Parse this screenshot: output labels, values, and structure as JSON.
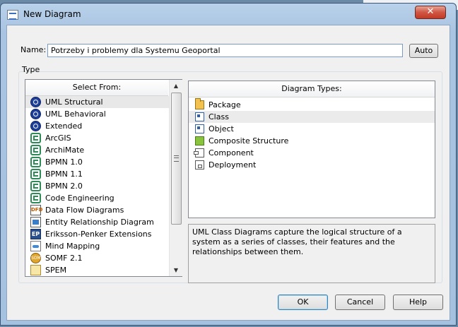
{
  "window": {
    "title": "New Diagram",
    "close_glyph": "✕"
  },
  "name_field": {
    "label": "Name:",
    "value": "Potrzeby i problemy dla Systemu Geoportal",
    "auto_button": "Auto"
  },
  "type_group": {
    "label": "Type"
  },
  "select_from": {
    "header": "Select From:",
    "items": [
      {
        "label": "UML Structural",
        "icon": "uml-icon",
        "selected": true
      },
      {
        "label": "UML Behavioral",
        "icon": "uml-icon"
      },
      {
        "label": "Extended",
        "icon": "uml-icon"
      },
      {
        "label": "ArcGIS",
        "icon": "technology-icon"
      },
      {
        "label": "ArchiMate",
        "icon": "technology-icon"
      },
      {
        "label": "BPMN 1.0",
        "icon": "technology-icon"
      },
      {
        "label": "BPMN 1.1",
        "icon": "technology-icon"
      },
      {
        "label": "BPMN 2.0",
        "icon": "technology-icon"
      },
      {
        "label": "Code Engineering",
        "icon": "technology-icon"
      },
      {
        "label": "Data Flow Diagrams",
        "icon": "dfd-icon"
      },
      {
        "label": "Entity Relationship Diagram",
        "icon": "erd-icon"
      },
      {
        "label": "Eriksson-Penker Extensions",
        "icon": "eriksson-penker-icon"
      },
      {
        "label": "Mind Mapping",
        "icon": "mind-mapping-icon"
      },
      {
        "label": "SOMF 2.1",
        "icon": "somf-icon"
      },
      {
        "label": "SPEM",
        "icon": "spem-icon"
      }
    ],
    "dfd_icon_text": "DFD",
    "ep_icon_text": "EP",
    "somf_icon_text": "SOMF"
  },
  "diagram_types": {
    "header": "Diagram Types:",
    "items": [
      {
        "label": "Package",
        "icon": "package-icon"
      },
      {
        "label": "Class",
        "icon": "class-icon",
        "selected": true
      },
      {
        "label": "Object",
        "icon": "object-icon"
      },
      {
        "label": "Composite Structure",
        "icon": "composite-structure-icon"
      },
      {
        "label": "Component",
        "icon": "component-icon"
      },
      {
        "label": "Deployment",
        "icon": "deployment-icon"
      }
    ]
  },
  "description": "UML Class Diagrams capture the logical structure of a system as a series of classes, their features and the relationships between them.",
  "buttons": {
    "ok": "OK",
    "cancel": "Cancel",
    "help": "Help"
  },
  "scrollbar": {
    "up_glyph": "▲",
    "down_glyph": "▼"
  }
}
